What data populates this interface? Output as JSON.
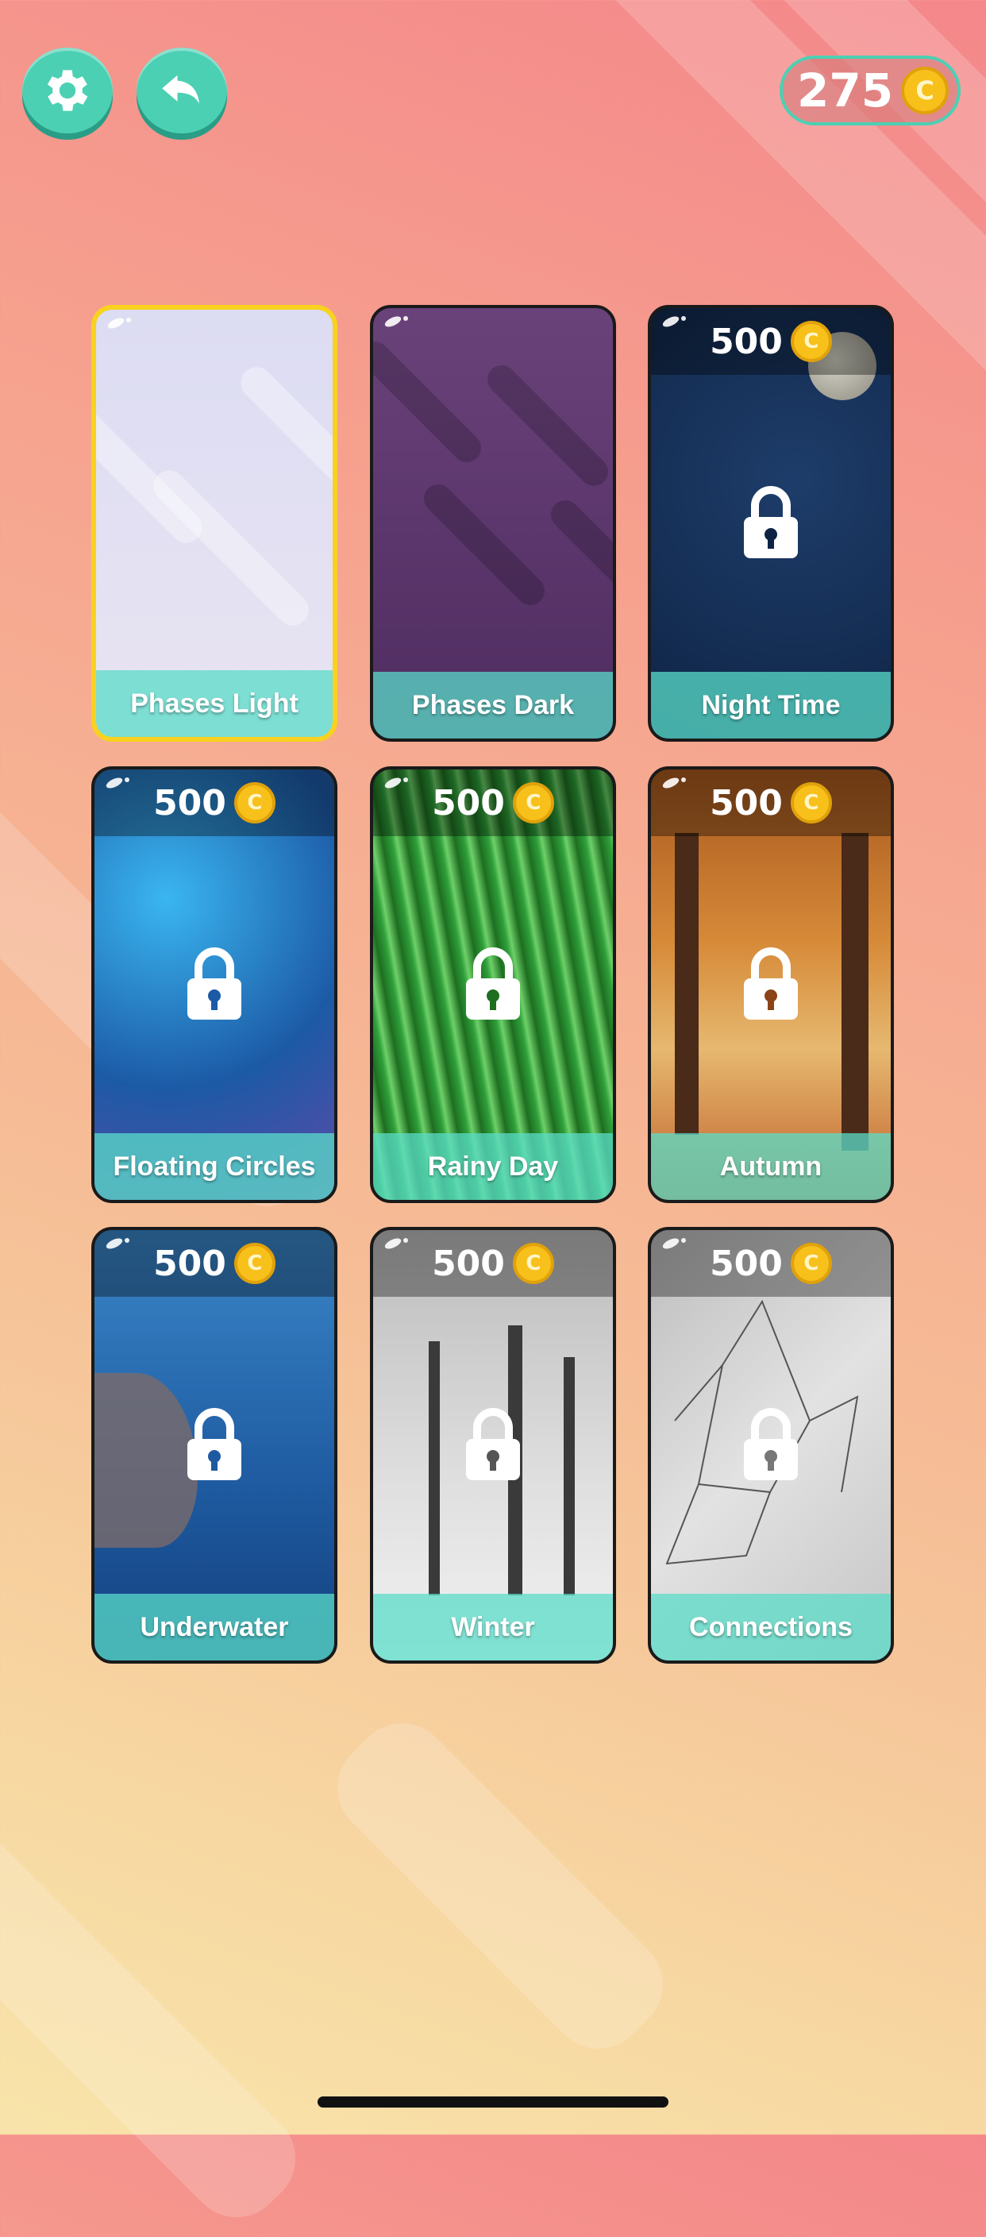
{
  "header": {
    "coins": "275",
    "coin_symbol": "C",
    "settings_icon": "gear-icon",
    "back_icon": "back-arrow-icon"
  },
  "themes": [
    {
      "name": "Phases Light",
      "price": "",
      "locked": false,
      "selected": true
    },
    {
      "name": "Phases Dark",
      "price": "",
      "locked": false,
      "selected": false
    },
    {
      "name": "Night Time",
      "price": "500",
      "locked": true,
      "selected": false
    },
    {
      "name": "Floating Circles",
      "price": "500",
      "locked": true,
      "selected": false
    },
    {
      "name": "Rainy Day",
      "price": "500",
      "locked": true,
      "selected": false
    },
    {
      "name": "Autumn",
      "price": "500",
      "locked": true,
      "selected": false
    },
    {
      "name": "Underwater",
      "price": "500",
      "locked": true,
      "selected": false
    },
    {
      "name": "Winter",
      "price": "500",
      "locked": true,
      "selected": false
    },
    {
      "name": "Connections",
      "price": "500",
      "locked": true,
      "selected": false
    }
  ],
  "colors": {
    "accent": "#4cd0b3",
    "selected_border": "#f8d21e",
    "coin": "#f7c01b"
  }
}
